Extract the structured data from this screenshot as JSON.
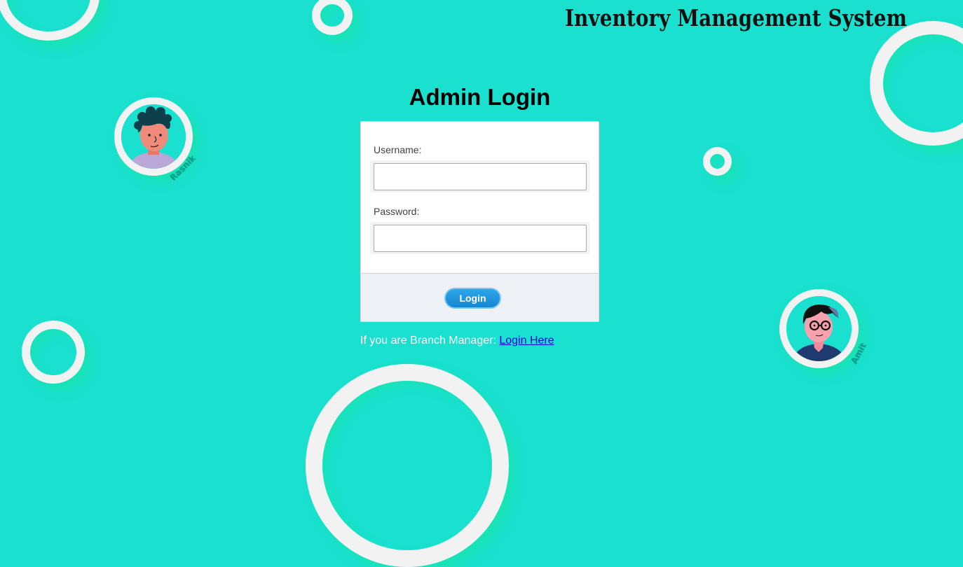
{
  "header": {
    "app_title": "Inventory Management System"
  },
  "avatars": [
    {
      "icon": "person-curly-hair-icon",
      "tag": "Rasnik"
    },
    {
      "icon": "person-glasses-icon",
      "tag": "Amit"
    }
  ],
  "login": {
    "heading": "Admin Login",
    "username_label": "Username:",
    "username_value": "",
    "password_label": "Password:",
    "password_value": "",
    "button_label": "Login"
  },
  "footer": {
    "manager_prompt": "If you are Branch Manager:",
    "manager_link": "Login Here"
  },
  "colors": {
    "background": "#19e0cf",
    "ring": "#f2f2f2",
    "button": "#1e96de",
    "link": "#0000ee"
  }
}
